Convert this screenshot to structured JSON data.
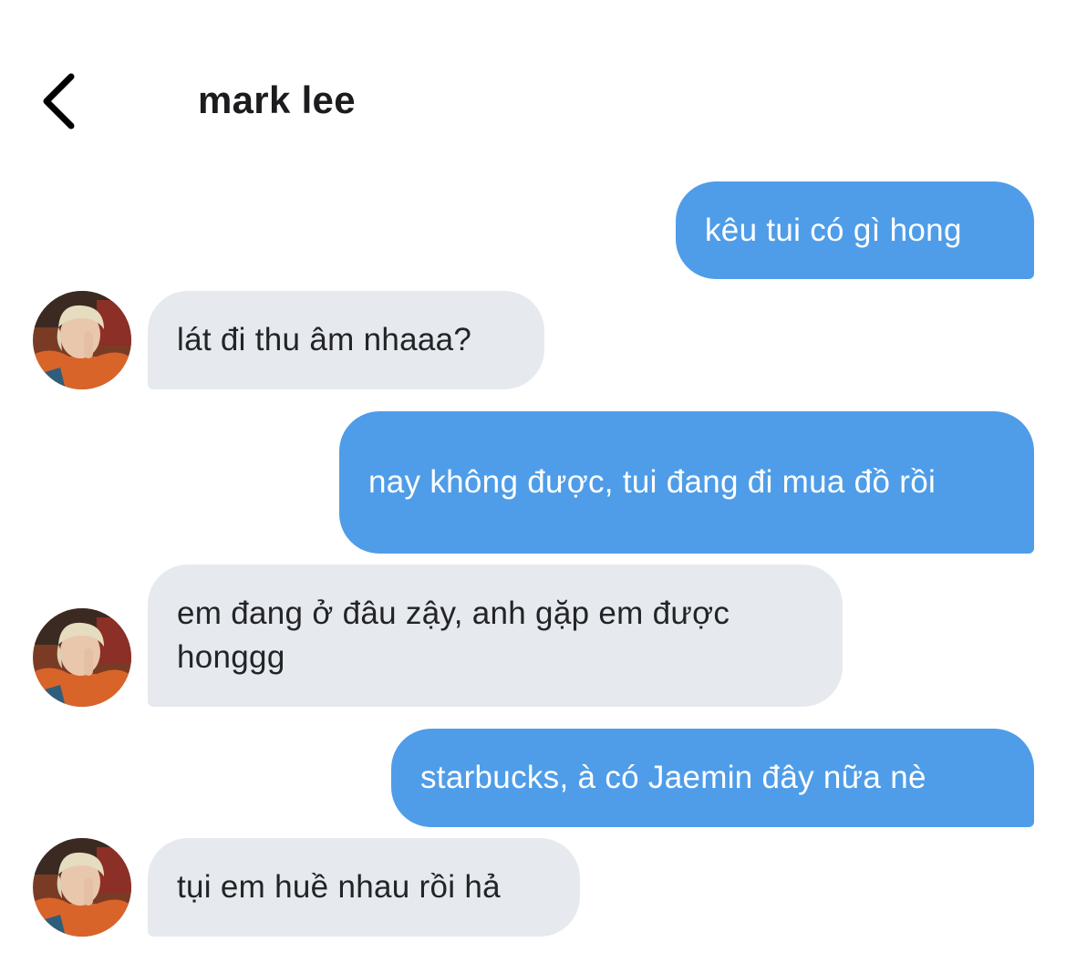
{
  "header": {
    "title": "mark lee",
    "back_icon": "chevron-left-icon"
  },
  "contact": {
    "avatar_icon": "avatar-photo"
  },
  "colors": {
    "sent_bubble": "#4f9de8",
    "received_bubble": "#e6eaef"
  },
  "messages": [
    {
      "from": "me",
      "text": "kêu tui có gì hong"
    },
    {
      "from": "contact",
      "text": "lát đi thu âm nhaaa?"
    },
    {
      "from": "me",
      "text": "nay không được, tui đang đi mua đồ rồi"
    },
    {
      "from": "contact",
      "text": "em đang ở đâu zậy, anh gặp em được honggg"
    },
    {
      "from": "me",
      "text": "starbucks, à có Jaemin đây nữa nè"
    },
    {
      "from": "contact",
      "text": "tụi em huề nhau rồi hả"
    }
  ]
}
